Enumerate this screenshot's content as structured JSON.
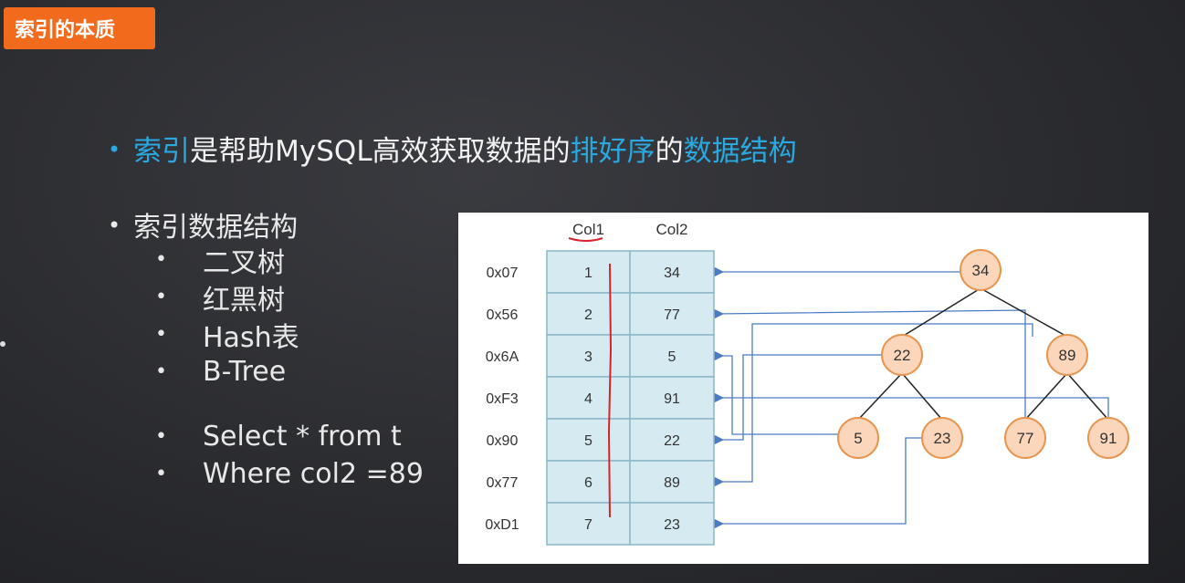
{
  "title": "索引的本质",
  "headline": {
    "part1": "索引",
    "part2": "是帮助MySQL高效获取数据的",
    "part3": "排好序",
    "part4": "的",
    "part5": "数据结构"
  },
  "section_title": "索引数据结构",
  "structures": [
    "二叉树",
    "红黑树",
    "Hash表",
    "B-Tree"
  ],
  "query_lines": [
    "Select * from t",
    "Where col2 =89"
  ],
  "table": {
    "headers": [
      "Col1",
      "Col2"
    ],
    "rows": [
      {
        "addr": "0x07",
        "col1": "1",
        "col2": "34"
      },
      {
        "addr": "0x56",
        "col1": "2",
        "col2": "77"
      },
      {
        "addr": "0x6A",
        "col1": "3",
        "col2": "5"
      },
      {
        "addr": "0xF3",
        "col1": "4",
        "col2": "91"
      },
      {
        "addr": "0x90",
        "col1": "5",
        "col2": "22"
      },
      {
        "addr": "0x77",
        "col1": "6",
        "col2": "89"
      },
      {
        "addr": "0xD1",
        "col1": "7",
        "col2": "23"
      }
    ]
  },
  "tree": {
    "root": "34",
    "level1": [
      "22",
      "89"
    ],
    "level2": [
      "5",
      "23",
      "77",
      "91"
    ]
  },
  "colors": {
    "accent_orange": "#f26b1d",
    "highlight_blue": "#2aa8e0",
    "table_fill": "#d5ebf1",
    "table_border": "#8cb7c6",
    "node_fill": "#fbd6bb",
    "node_border": "#e8954f",
    "pointer_line": "#4a7cc4",
    "annotation_red": "#d9232a"
  }
}
